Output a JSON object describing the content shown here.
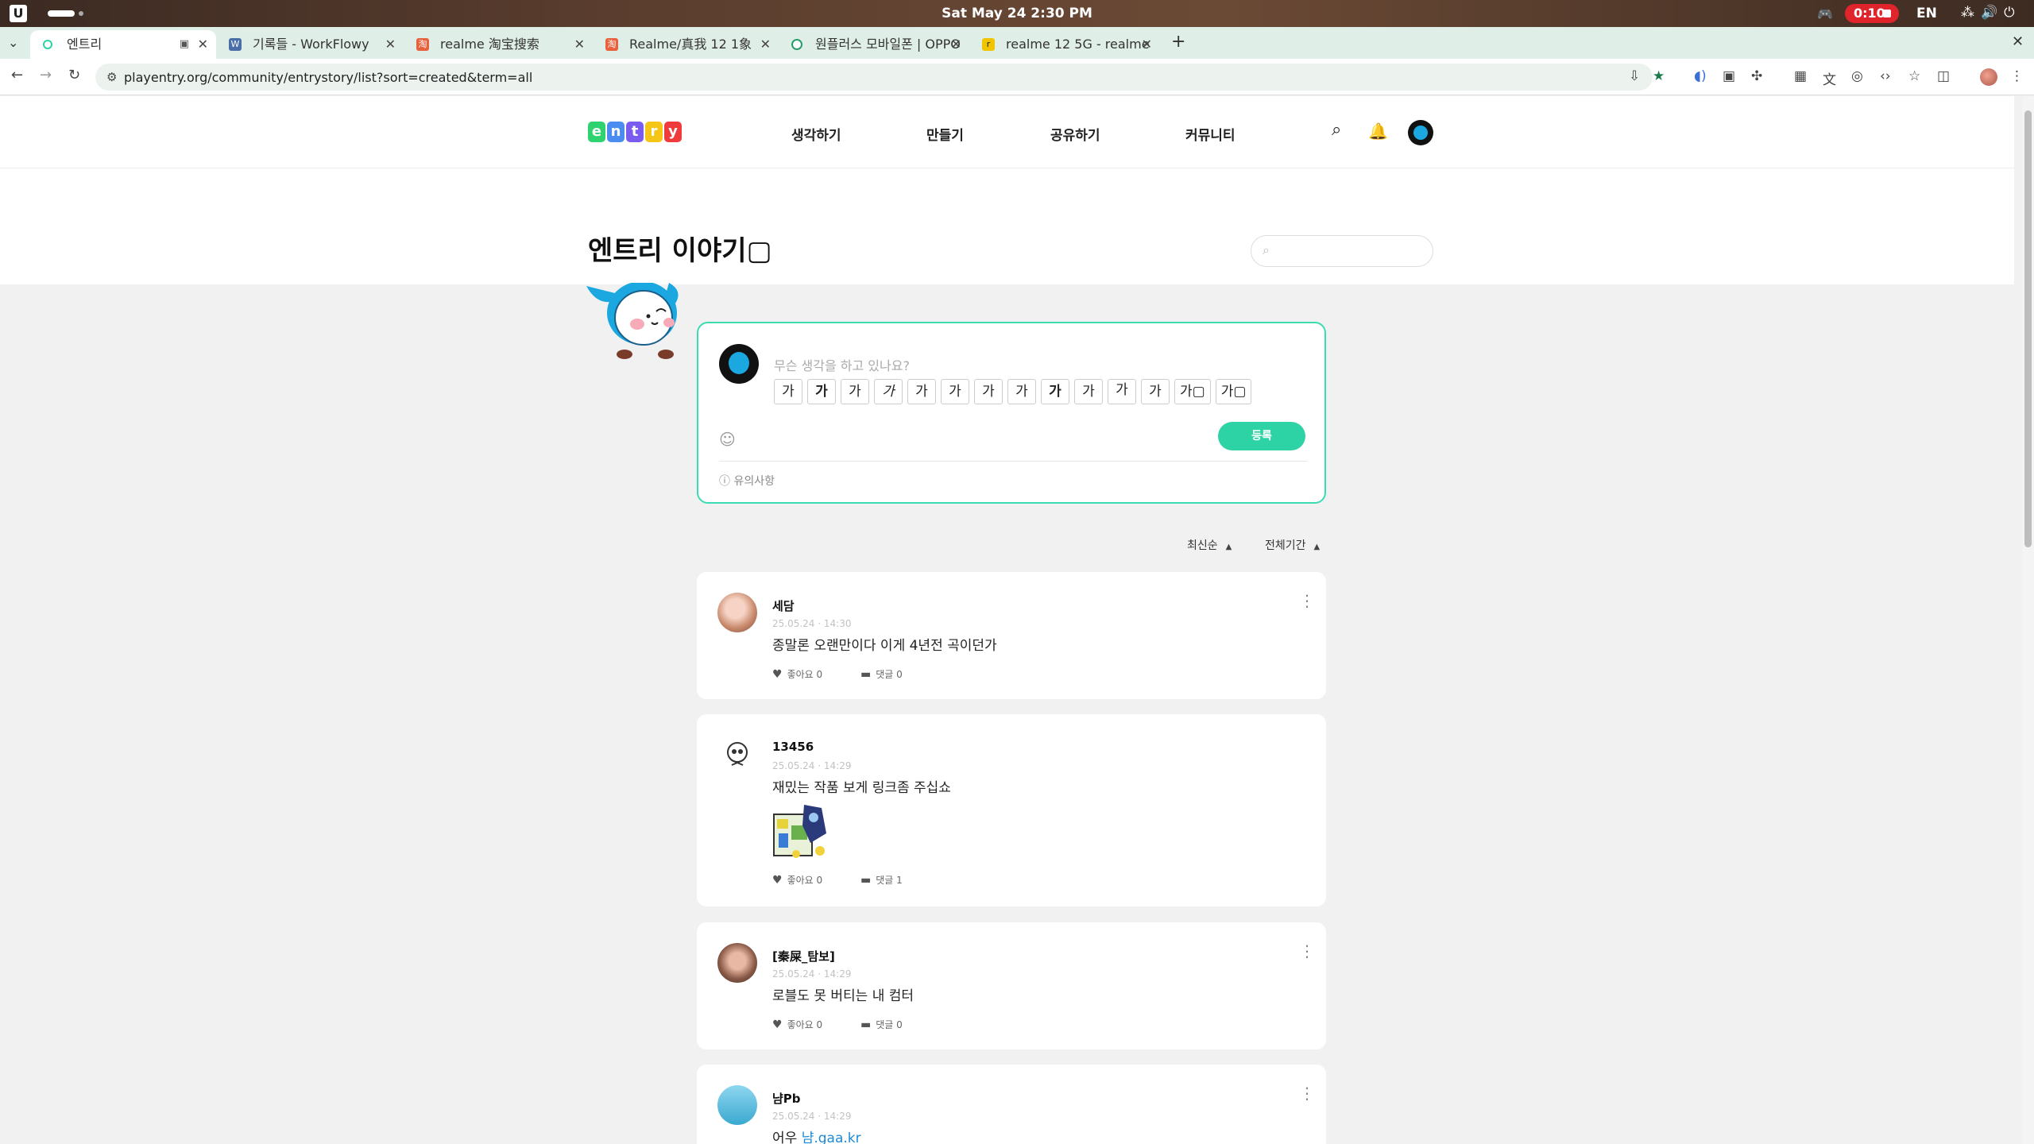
{
  "os": {
    "clock": "Sat May 24   2:30 PM",
    "record_time": "0:10",
    "language": "EN"
  },
  "tabs": [
    {
      "title": "엔트리",
      "active": true,
      "color": "#2ed3a5"
    },
    {
      "title": "기록들 - WorkFlowy",
      "active": false,
      "color": "#4a6ea8"
    },
    {
      "title": "realme 淘宝搜索",
      "active": false,
      "color": "#e8603c"
    },
    {
      "title": "Realme/真我 12 1象",
      "active": false,
      "color": "#e8603c"
    },
    {
      "title": "원플러스 모바일폰 | OPPO",
      "active": false,
      "color": "#2a9d68"
    },
    {
      "title": "realme 12 5G - realme",
      "active": false,
      "color": "#f0c400"
    }
  ],
  "browser": {
    "url": "playentry.org/community/entrystory/list?sort=created&term=all"
  },
  "site": {
    "logo_letters": [
      "e",
      "n",
      "t",
      "r",
      "y"
    ],
    "logo_colors": [
      "#2ed36f",
      "#4a8cf0",
      "#7b5cf0",
      "#f5c518",
      "#ef3b3b"
    ],
    "nav": [
      "생각하기",
      "만들기",
      "공유하기",
      "커뮤니티"
    ]
  },
  "page": {
    "title": "엔트리 이야기▢",
    "search_placeholder": ""
  },
  "composer": {
    "placeholder": "무슨 생각을 하고 있나요?",
    "font_chips": [
      "가",
      "가",
      "가",
      "가",
      "가",
      "가",
      "가",
      "가",
      "가",
      "가",
      "가",
      "가",
      "가▢",
      "가▢"
    ],
    "submit_label": "등록",
    "notice_label": "유의사항"
  },
  "sort": {
    "order_label": "최신순",
    "term_label": "전체기간"
  },
  "posts": [
    {
      "user": "세담",
      "time": "25.05.24 · 14:30",
      "text": "종말론 오랜만이다 이게 4년전 곡이던가",
      "likes": "좋아요 0",
      "comments": "댓글 0"
    },
    {
      "user": "13456",
      "time": "25.05.24 · 14:29",
      "text": "재밌는 작품 보게 링크좀 주십쇼",
      "likes": "좋아요 0",
      "comments": "댓글 1"
    },
    {
      "user": "[秦屎_탐보]",
      "time": "25.05.24 · 14:29",
      "text": "로블도 못 버티는 내 컴터",
      "likes": "좋아요 0",
      "comments": "댓글 0"
    },
    {
      "user": "냠Pb",
      "time": "25.05.24 · 14:29",
      "text_prefix": "어우 ",
      "text_link": "냠.gaa.kr"
    }
  ]
}
